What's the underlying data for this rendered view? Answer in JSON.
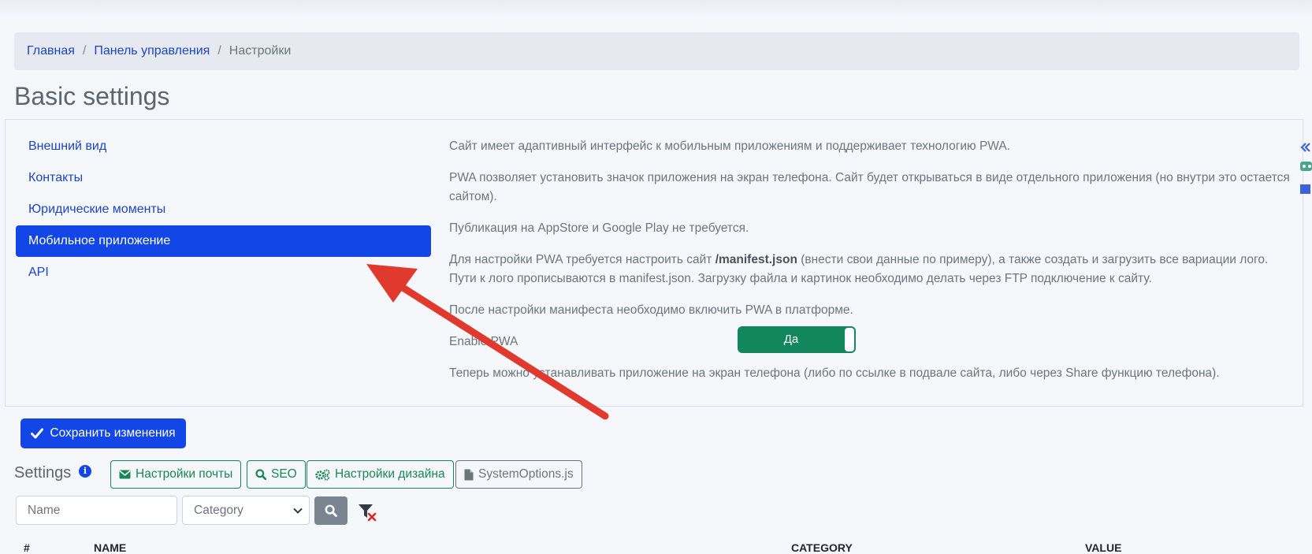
{
  "breadcrumb": {
    "items": [
      "Главная",
      "Панель управления"
    ],
    "current": "Настройки",
    "separator": "/"
  },
  "page_title": "Basic settings",
  "nav": {
    "items": [
      "Внешний вид",
      "Контакты",
      "Юридические моменты",
      "Мобильное приложение",
      "API"
    ],
    "active_index": 3
  },
  "content": {
    "p1": "Сайт имеет адаптивный интерфейс к мобильным приложениям и поддерживает технологию PWA.",
    "p2": "PWA позволяет установить значок приложения на экран телефона. Сайт будет открываться в виде отдельного приложения (но внутри это остается сайтом).",
    "p3": "Публикация на AppStore и Google Play не требуется.",
    "p4_before": "Для настройки PWA требуется настроить сайт ",
    "p4_bold": "/manifest.json",
    "p4_after": " (внести свои данные по примеру), а также создать и загрузить все вариации лого. Пути к лого прописываются в manifest.json. Загрузку файла и картинок необходимо делать через FTP подключение к сайту.",
    "p5": "После настройки манифеста необходимо включить PWA в платформе.",
    "enable_label": "Enable PWA",
    "toggle_value": "Да",
    "toggle_on": true,
    "p6": "Теперь можно устанавливать приложение на экран телефона (либо по ссылке в подвале сайта, либо через Share функцию телефона)."
  },
  "save_button": "Сохранить изменения",
  "settings": {
    "label": "Settings",
    "info_icon": "i",
    "buttons": [
      "Настройки почты",
      "SEO",
      "Настройки дизайна",
      "SystemOptions.js"
    ]
  },
  "filters": {
    "name_placeholder": "Name",
    "category_selected": "Category"
  },
  "table_headers": [
    "#",
    "NAME",
    "CATEGORY",
    "VALUE"
  ],
  "colors": {
    "primary": "#1246e6",
    "success": "#198754",
    "toggle": "#12865c",
    "arrow": "#e03a2f"
  }
}
